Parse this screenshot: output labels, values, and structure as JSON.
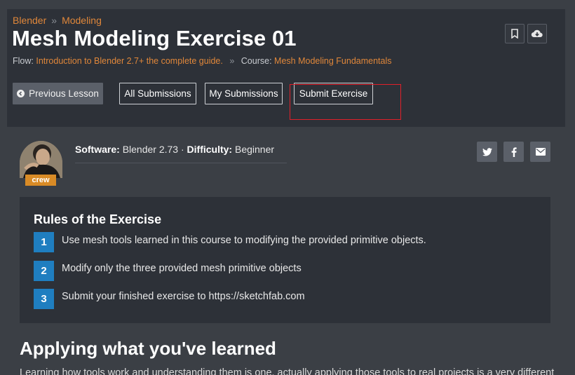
{
  "breadcrumb": {
    "items": [
      "Blender",
      "Modeling"
    ],
    "separator": "»"
  },
  "page": {
    "title": "Mesh Modeling Exercise 01"
  },
  "flow": {
    "flow_label": "Flow:",
    "flow_link": "Introduction to Blender 2.7+ the complete guide.",
    "separator": "»",
    "course_label": "Course:",
    "course_link": "Mesh Modeling Fundamentals"
  },
  "header_icons": {
    "bookmark": "bookmark-icon",
    "download": "cloud-download-icon"
  },
  "buttons": {
    "previous": "Previous Lesson",
    "all_submissions": "All Submissions",
    "my_submissions": "My Submissions",
    "submit": "Submit Exercise"
  },
  "author": {
    "badge": "crew"
  },
  "meta": {
    "software_label": "Software:",
    "software_value": "Blender 2.73",
    "dot": "·",
    "difficulty_label": "Difficulty:",
    "difficulty_value": "Beginner"
  },
  "share": [
    "twitter-icon",
    "facebook-icon",
    "mail-icon"
  ],
  "rules": {
    "title": "Rules of the Exercise",
    "items": [
      {
        "num": "1",
        "text": "Use mesh tools learned in this course to modifying the provided primitive objects."
      },
      {
        "num": "2",
        "text": "Modify only the three provided mesh primitive objects"
      },
      {
        "num": "3",
        "text": "Submit your finished exercise to https://sketchfab.com"
      }
    ]
  },
  "section": {
    "title": "Applying what you've learned",
    "intro": "Learning how tools work and understanding them is one, actually applying those tools to real projects is a very different"
  },
  "colors": {
    "accent": "#e0873a",
    "rule_badge": "#1f7ec0",
    "crew_badge": "#d98b26",
    "panel": "#2d3138",
    "highlight": "#e0202a"
  }
}
